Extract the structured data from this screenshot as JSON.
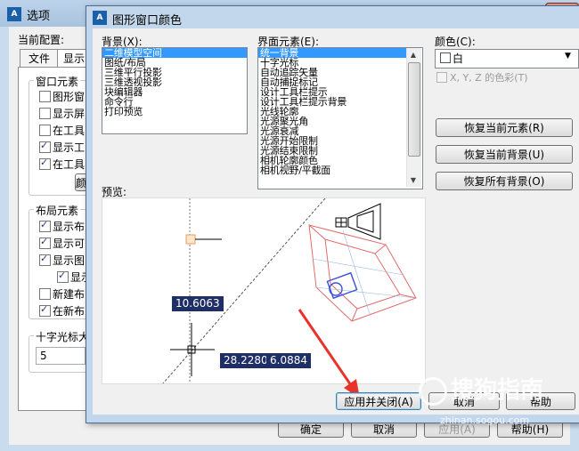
{
  "options_window": {
    "title": "选项",
    "close_label": "x",
    "current_config_label": "当前配置:",
    "tabs": [
      "文件",
      "显示"
    ],
    "window_elements_title": "窗口元素",
    "window_elements": [
      {
        "label": "图形窗",
        "checked": false
      },
      {
        "label": "显示屏",
        "checked": false
      },
      {
        "label": "在工具",
        "checked": false
      },
      {
        "label": "显示工",
        "checked": true
      },
      {
        "label": "在工具",
        "checked": true
      }
    ],
    "colors_button_partial": "颜",
    "layout_elements_title": "布局元素",
    "layout_elements": [
      {
        "label": "显示布",
        "checked": true
      },
      {
        "label": "显示可",
        "checked": true
      },
      {
        "label": "显示图",
        "checked": true
      },
      {
        "label": "显示",
        "checked": true
      },
      {
        "label": "新建布",
        "checked": false
      },
      {
        "label": "在新布",
        "checked": true
      }
    ],
    "crosshair_title": "十字光标大",
    "crosshair_value": "5",
    "buttons": {
      "ok": "确定",
      "cancel": "取消",
      "apply": "应用(A)",
      "help": "帮助(H)"
    }
  },
  "dialog": {
    "title": "图形窗口颜色",
    "background_label": "背景(X):",
    "background_items": [
      "二维模型空间",
      "图纸/布局",
      "三维平行投影",
      "三维透视投影",
      "块编辑器",
      "命令行",
      "打印预览"
    ],
    "background_selected": 0,
    "ui_element_label": "界面元素(E):",
    "ui_elements": [
      "统一背景",
      "十字光标",
      "自动追踪矢量",
      "自动捕捉标记",
      "设计工具栏提示",
      "设计工具栏提示背景",
      "光线轮廓",
      "光源聚光角",
      "光源衰减",
      "光源开始限制",
      "光源结束限制",
      "相机轮廓颜色",
      "相机视野/平截面"
    ],
    "ui_selected": 0,
    "color_label": "颜色(C):",
    "color_value": "白",
    "xyz_label": "X, Y, Z 的色彩(T)",
    "restore_current_element": "恢复当前元素(R)",
    "restore_current_background": "恢复当前背景(U)",
    "restore_all_backgrounds": "恢复所有背景(O)",
    "preview_label": "预览:",
    "preview_values": {
      "length": "10.6063",
      "x": "28.2280",
      "y": "6.0884"
    },
    "apply_close": "应用并关闭(A)",
    "cancel": "取消",
    "help": "帮助"
  },
  "watermark": {
    "text": "搜狗指南",
    "url": "zhinan.sogou.com"
  },
  "colors": {
    "accent_selection": "#3399ff",
    "preview_tag": "#1f2f66",
    "arrow": "#e8322a"
  }
}
